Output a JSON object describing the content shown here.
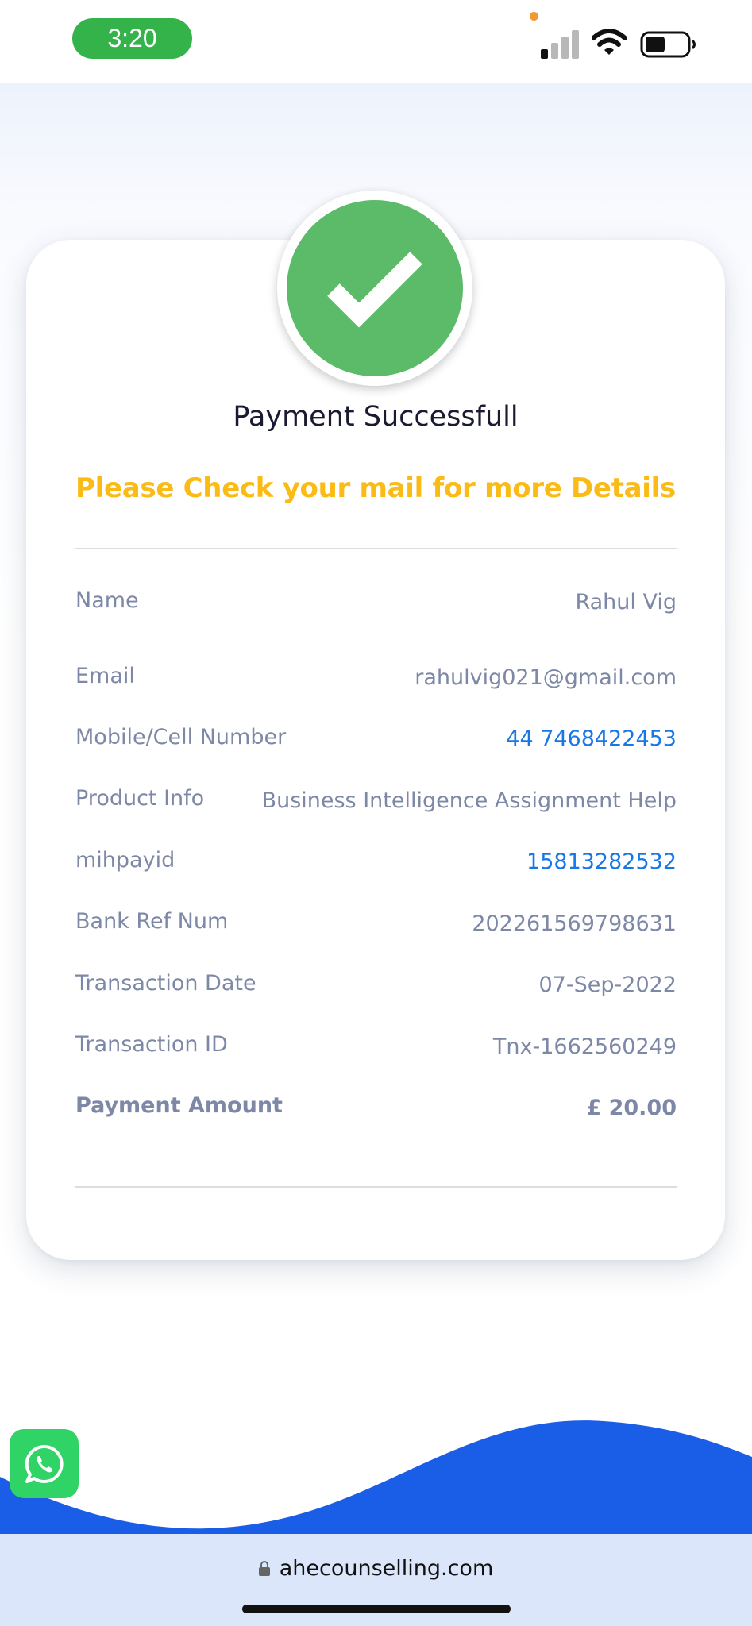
{
  "status_bar": {
    "time": "3:20",
    "time_pill_color": "#33b34a"
  },
  "payment": {
    "icon": "checkmark-icon",
    "title": "Payment Successfull",
    "subtitle": "Please Check your mail for more Details",
    "success_color": "#5cbb68",
    "subtitle_color": "#fbbb17"
  },
  "details": {
    "rows": [
      {
        "label": "Name",
        "value": "Rahul Vig"
      },
      {
        "label": "Email",
        "value": "rahulvig021@gmail.com"
      },
      {
        "label": "Mobile/Cell Number",
        "value": "44 7468422453"
      },
      {
        "label": "Product Info",
        "value": "Business Intelligence Assignment Help"
      },
      {
        "label": "mihpayid",
        "value": "15813282532"
      },
      {
        "label": "Bank Ref Num",
        "value": "202261569798631"
      },
      {
        "label": "Transaction Date",
        "value": "07-Sep-2022"
      },
      {
        "label": "Transaction ID",
        "value": "Tnx-1662560249"
      },
      {
        "label": "Payment Amount",
        "value": "£ 20.00"
      }
    ]
  },
  "browser": {
    "url": "ahecounselling.com"
  },
  "colors": {
    "wave_blue": "#1a5ee8",
    "address_bar": "#dbe6fb",
    "whatsapp": "#2fd366",
    "link_blue": "#1877e6"
  }
}
